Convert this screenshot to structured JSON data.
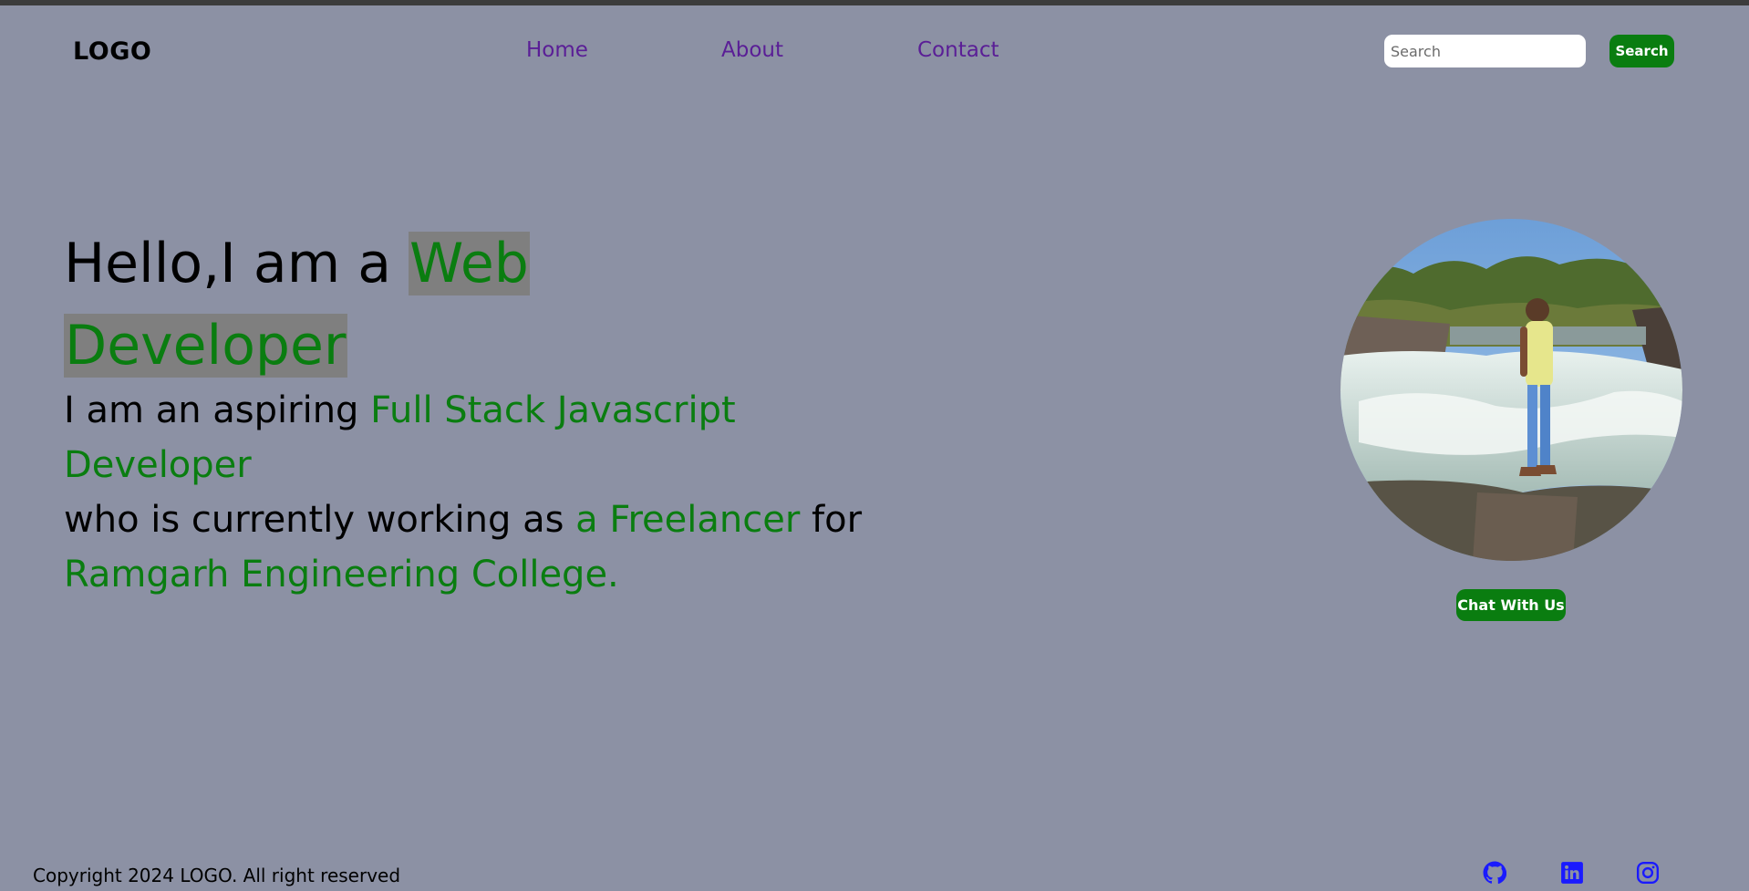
{
  "header": {
    "logo": "LOGO",
    "nav": [
      {
        "label": "Home"
      },
      {
        "label": "About"
      },
      {
        "label": "Contact"
      }
    ],
    "search": {
      "placeholder": "Search",
      "value": "",
      "button_label": "Search"
    }
  },
  "hero": {
    "title_prefix": "Hello,I am a ",
    "title_highlight_1": "Web",
    "title_highlight_2": "Developer",
    "line1_prefix": "I am an aspiring ",
    "line1_highlight": "Full Stack Javascript Developer",
    "line2_prefix": "who is currently working as ",
    "line2_highlight": "a Freelancer",
    "line2_suffix": " for",
    "line3_highlight": "Ramgarh Engineering College."
  },
  "profile": {
    "chat_button_label": "Chat With Us"
  },
  "footer": {
    "copyright": "Copyright 2024 LOGO. All right reserved",
    "social_icons": [
      "github-icon",
      "linkedin-icon",
      "instagram-icon"
    ]
  },
  "colors": {
    "background": "#8c91a4",
    "accent_green": "#0a7d10",
    "nav_purple": "#5a1e96",
    "highlight_gray": "#7f7f7f",
    "social_blue": "#1a1aff"
  }
}
